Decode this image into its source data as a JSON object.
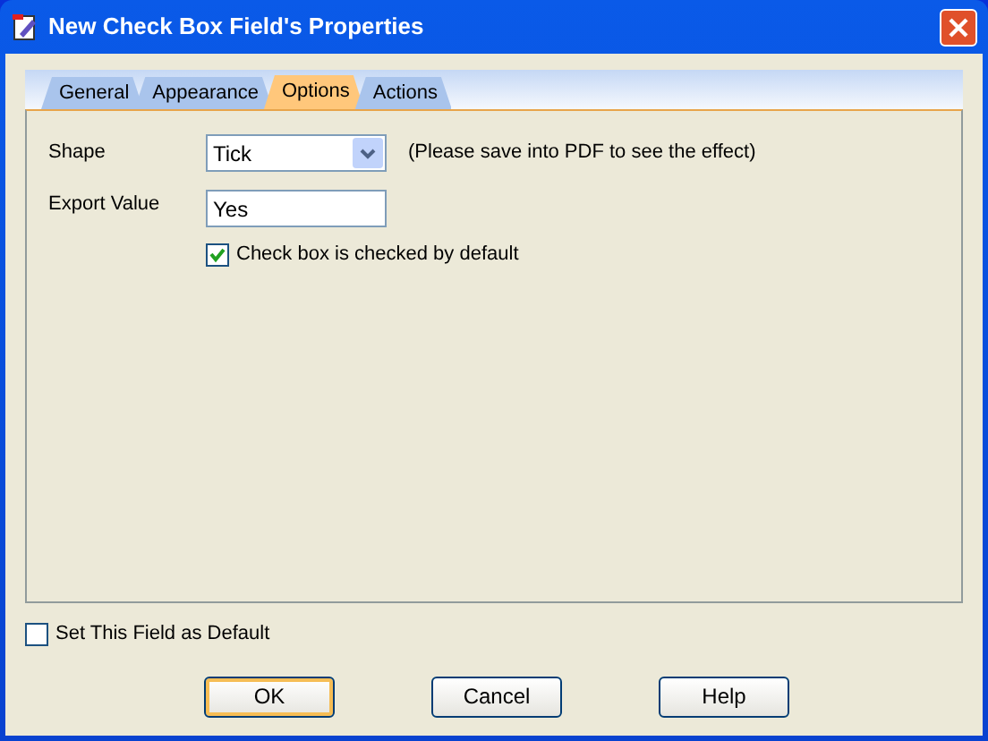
{
  "window": {
    "title": "New Check Box Field's Properties"
  },
  "tabs": [
    {
      "label": "General",
      "selected": false
    },
    {
      "label": "Appearance",
      "selected": false
    },
    {
      "label": "Options",
      "selected": true
    },
    {
      "label": "Actions",
      "selected": false
    }
  ],
  "shape": {
    "label": "Shape",
    "value": "Tick",
    "note": "(Please save into PDF to see the effect)"
  },
  "export_value": {
    "label": "Export Value",
    "value": "Yes"
  },
  "checked_by_default": {
    "label": "Check box is checked by default",
    "checked": true
  },
  "set_as_default": {
    "label": "Set This Field as Default",
    "checked": false
  },
  "buttons": [
    {
      "label": "OK",
      "focused": true
    },
    {
      "label": "Cancel",
      "focused": false
    },
    {
      "label": "Help",
      "focused": false
    }
  ]
}
